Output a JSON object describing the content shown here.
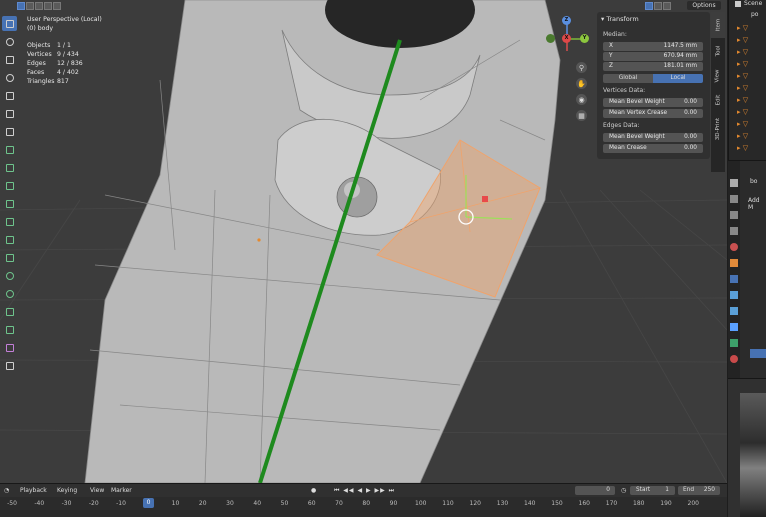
{
  "viewport": {
    "view_name": "User Perspective (Local)",
    "object_name": "(0) body",
    "options_label": "Options",
    "stats": [
      {
        "label": "Objects",
        "value": "1 / 1"
      },
      {
        "label": "Vertices",
        "value": "9 / 434"
      },
      {
        "label": "Edges",
        "value": "12 / 836"
      },
      {
        "label": "Faces",
        "value": "4 / 402"
      },
      {
        "label": "Triangles",
        "value": "817"
      }
    ],
    "gizmo": {
      "z": "Z",
      "y": "Y",
      "x": "X"
    },
    "colors": {
      "background": "#3c3c3c",
      "selection": "#f0a36b",
      "highlight_line": "#1e8a1e",
      "active_blue": "#4772b3"
    }
  },
  "transform_panel": {
    "title": "Transform",
    "median_label": "Median:",
    "fields": [
      {
        "key": "X",
        "value": "1147.5 mm"
      },
      {
        "key": "Y",
        "value": "670.94 mm"
      },
      {
        "key": "Z",
        "value": "181.01 mm"
      }
    ],
    "space_options": [
      "Global",
      "Local"
    ],
    "space_selected": "Local",
    "vertices_data_label": "Vertices Data:",
    "vertex_fields": [
      {
        "key": "Mean Bevel Weight",
        "value": "0.00"
      },
      {
        "key": "Mean Vertex Crease",
        "value": "0.00"
      }
    ],
    "edges_data_label": "Edges Data:",
    "edge_fields": [
      {
        "key": "Mean Bevel Weight",
        "value": "0.00"
      },
      {
        "key": "Mean Crease",
        "value": "0.00"
      }
    ]
  },
  "side_tabs": [
    "Item",
    "Tool",
    "View",
    "Edit",
    "3D-Print"
  ],
  "side_tab_active": "Item",
  "outliner": {
    "scene_label": "Scene",
    "item_label": "po"
  },
  "properties": {
    "object_label": "bo",
    "add_modifier_label": "Add M"
  },
  "timeline": {
    "menus": [
      "Playback",
      "Keying",
      "View",
      "Marker"
    ],
    "current_frame": "0",
    "start_label": "Start",
    "start_value": "1",
    "end_label": "End",
    "end_value": "250",
    "ruler": [
      "-50",
      "-40",
      "-30",
      "-20",
      "-10",
      "0",
      "10",
      "20",
      "30",
      "40",
      "50",
      "60",
      "70",
      "80",
      "90",
      "100",
      "110",
      "120",
      "130",
      "140",
      "150",
      "160",
      "170",
      "180",
      "190",
      "200"
    ],
    "playhead_label": "0"
  }
}
